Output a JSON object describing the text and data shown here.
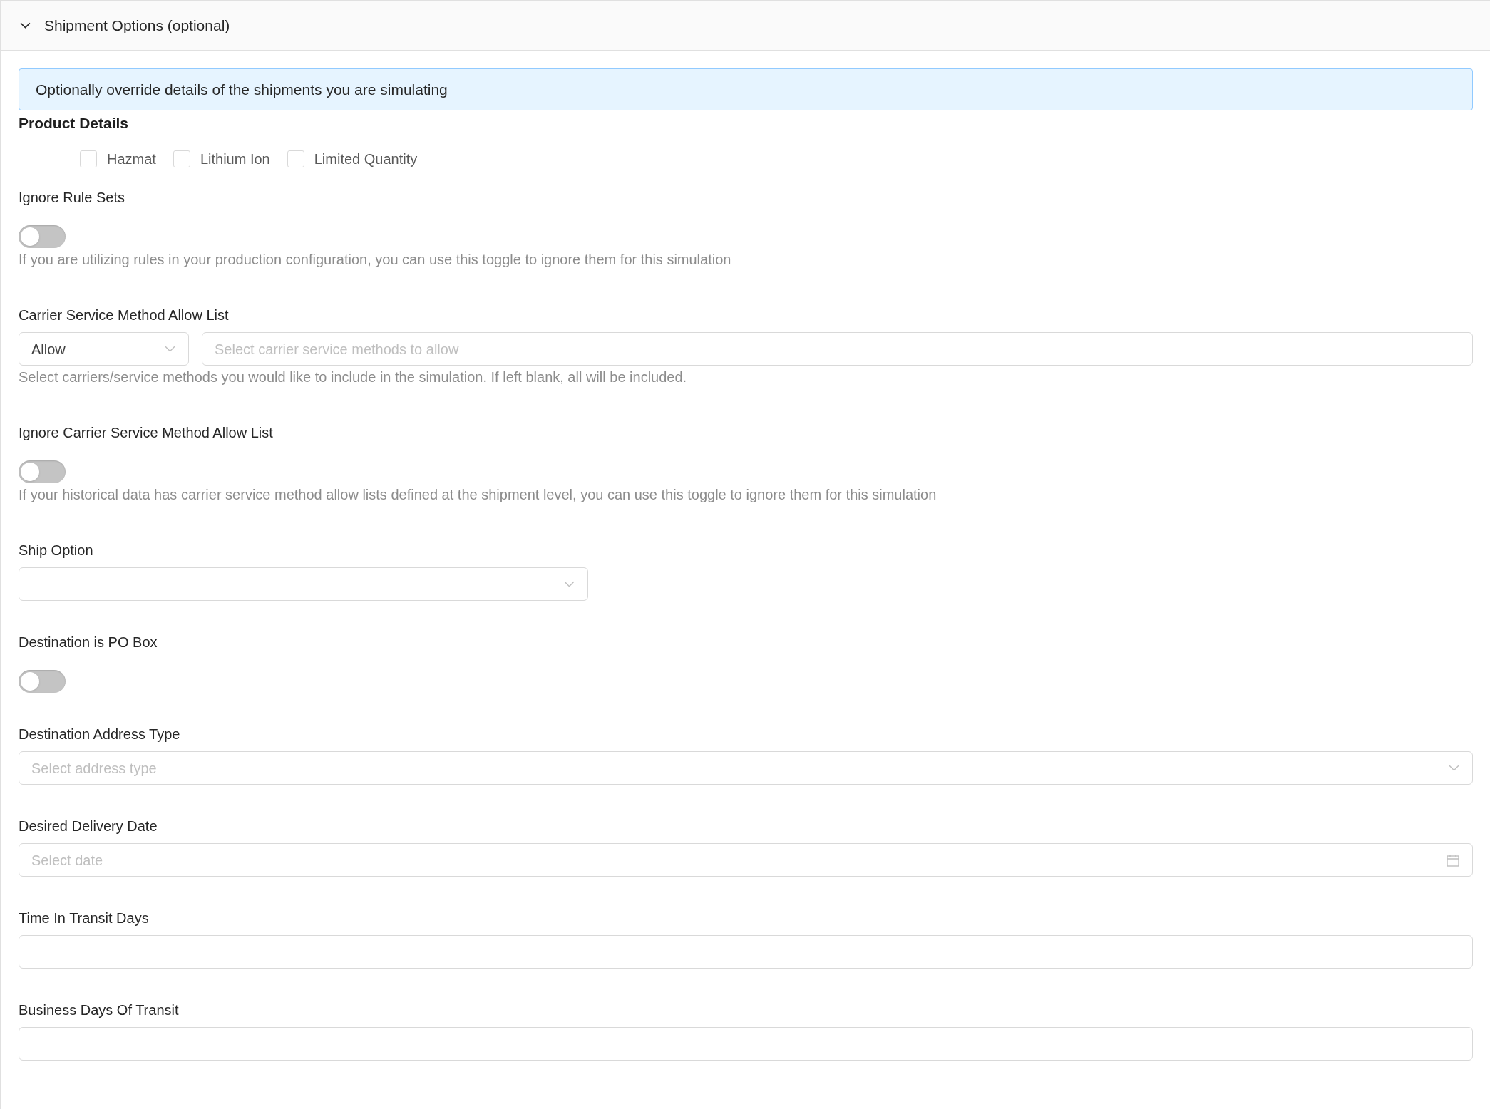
{
  "panel": {
    "title": "Shipment Options (optional)",
    "expanded": true
  },
  "alert": "Optionally override details of the shipments you are simulating",
  "product_details": {
    "title": "Product Details",
    "options": [
      {
        "label": "Hazmat",
        "checked": false
      },
      {
        "label": "Lithium Ion",
        "checked": false
      },
      {
        "label": "Limited Quantity",
        "checked": false
      }
    ]
  },
  "fields": [
    {
      "kind": "toggle",
      "label": "Ignore Rule Sets",
      "on": false,
      "help": "If you are utilizing rules in your production configuration, you can use this toggle to ignore them for this simulation"
    },
    {
      "kind": "allowlist",
      "label": "Carrier Service Method Allow List",
      "mode": "Allow",
      "placeholder": "Select carrier service methods to allow",
      "help": "Select carriers/service methods you would like to include in the simulation. If left blank, all will be included."
    },
    {
      "kind": "toggle",
      "label": "Ignore Carrier Service Method Allow List",
      "on": false,
      "help": "If your historical data has carrier service method allow lists defined at the shipment level, you can use this toggle to ignore them for this simulation"
    },
    {
      "kind": "select",
      "label": "Ship Option",
      "narrow": true
    },
    {
      "kind": "toggle",
      "label": "Destination is PO Box",
      "on": false
    },
    {
      "kind": "select",
      "label": "Destination Address Type",
      "placeholder": "Select address type"
    },
    {
      "kind": "date",
      "label": "Desired Delivery Date",
      "placeholder": "Select date"
    },
    {
      "kind": "text",
      "label": "Time In Transit Days"
    },
    {
      "kind": "text",
      "label": "Business Days Of Transit"
    }
  ]
}
